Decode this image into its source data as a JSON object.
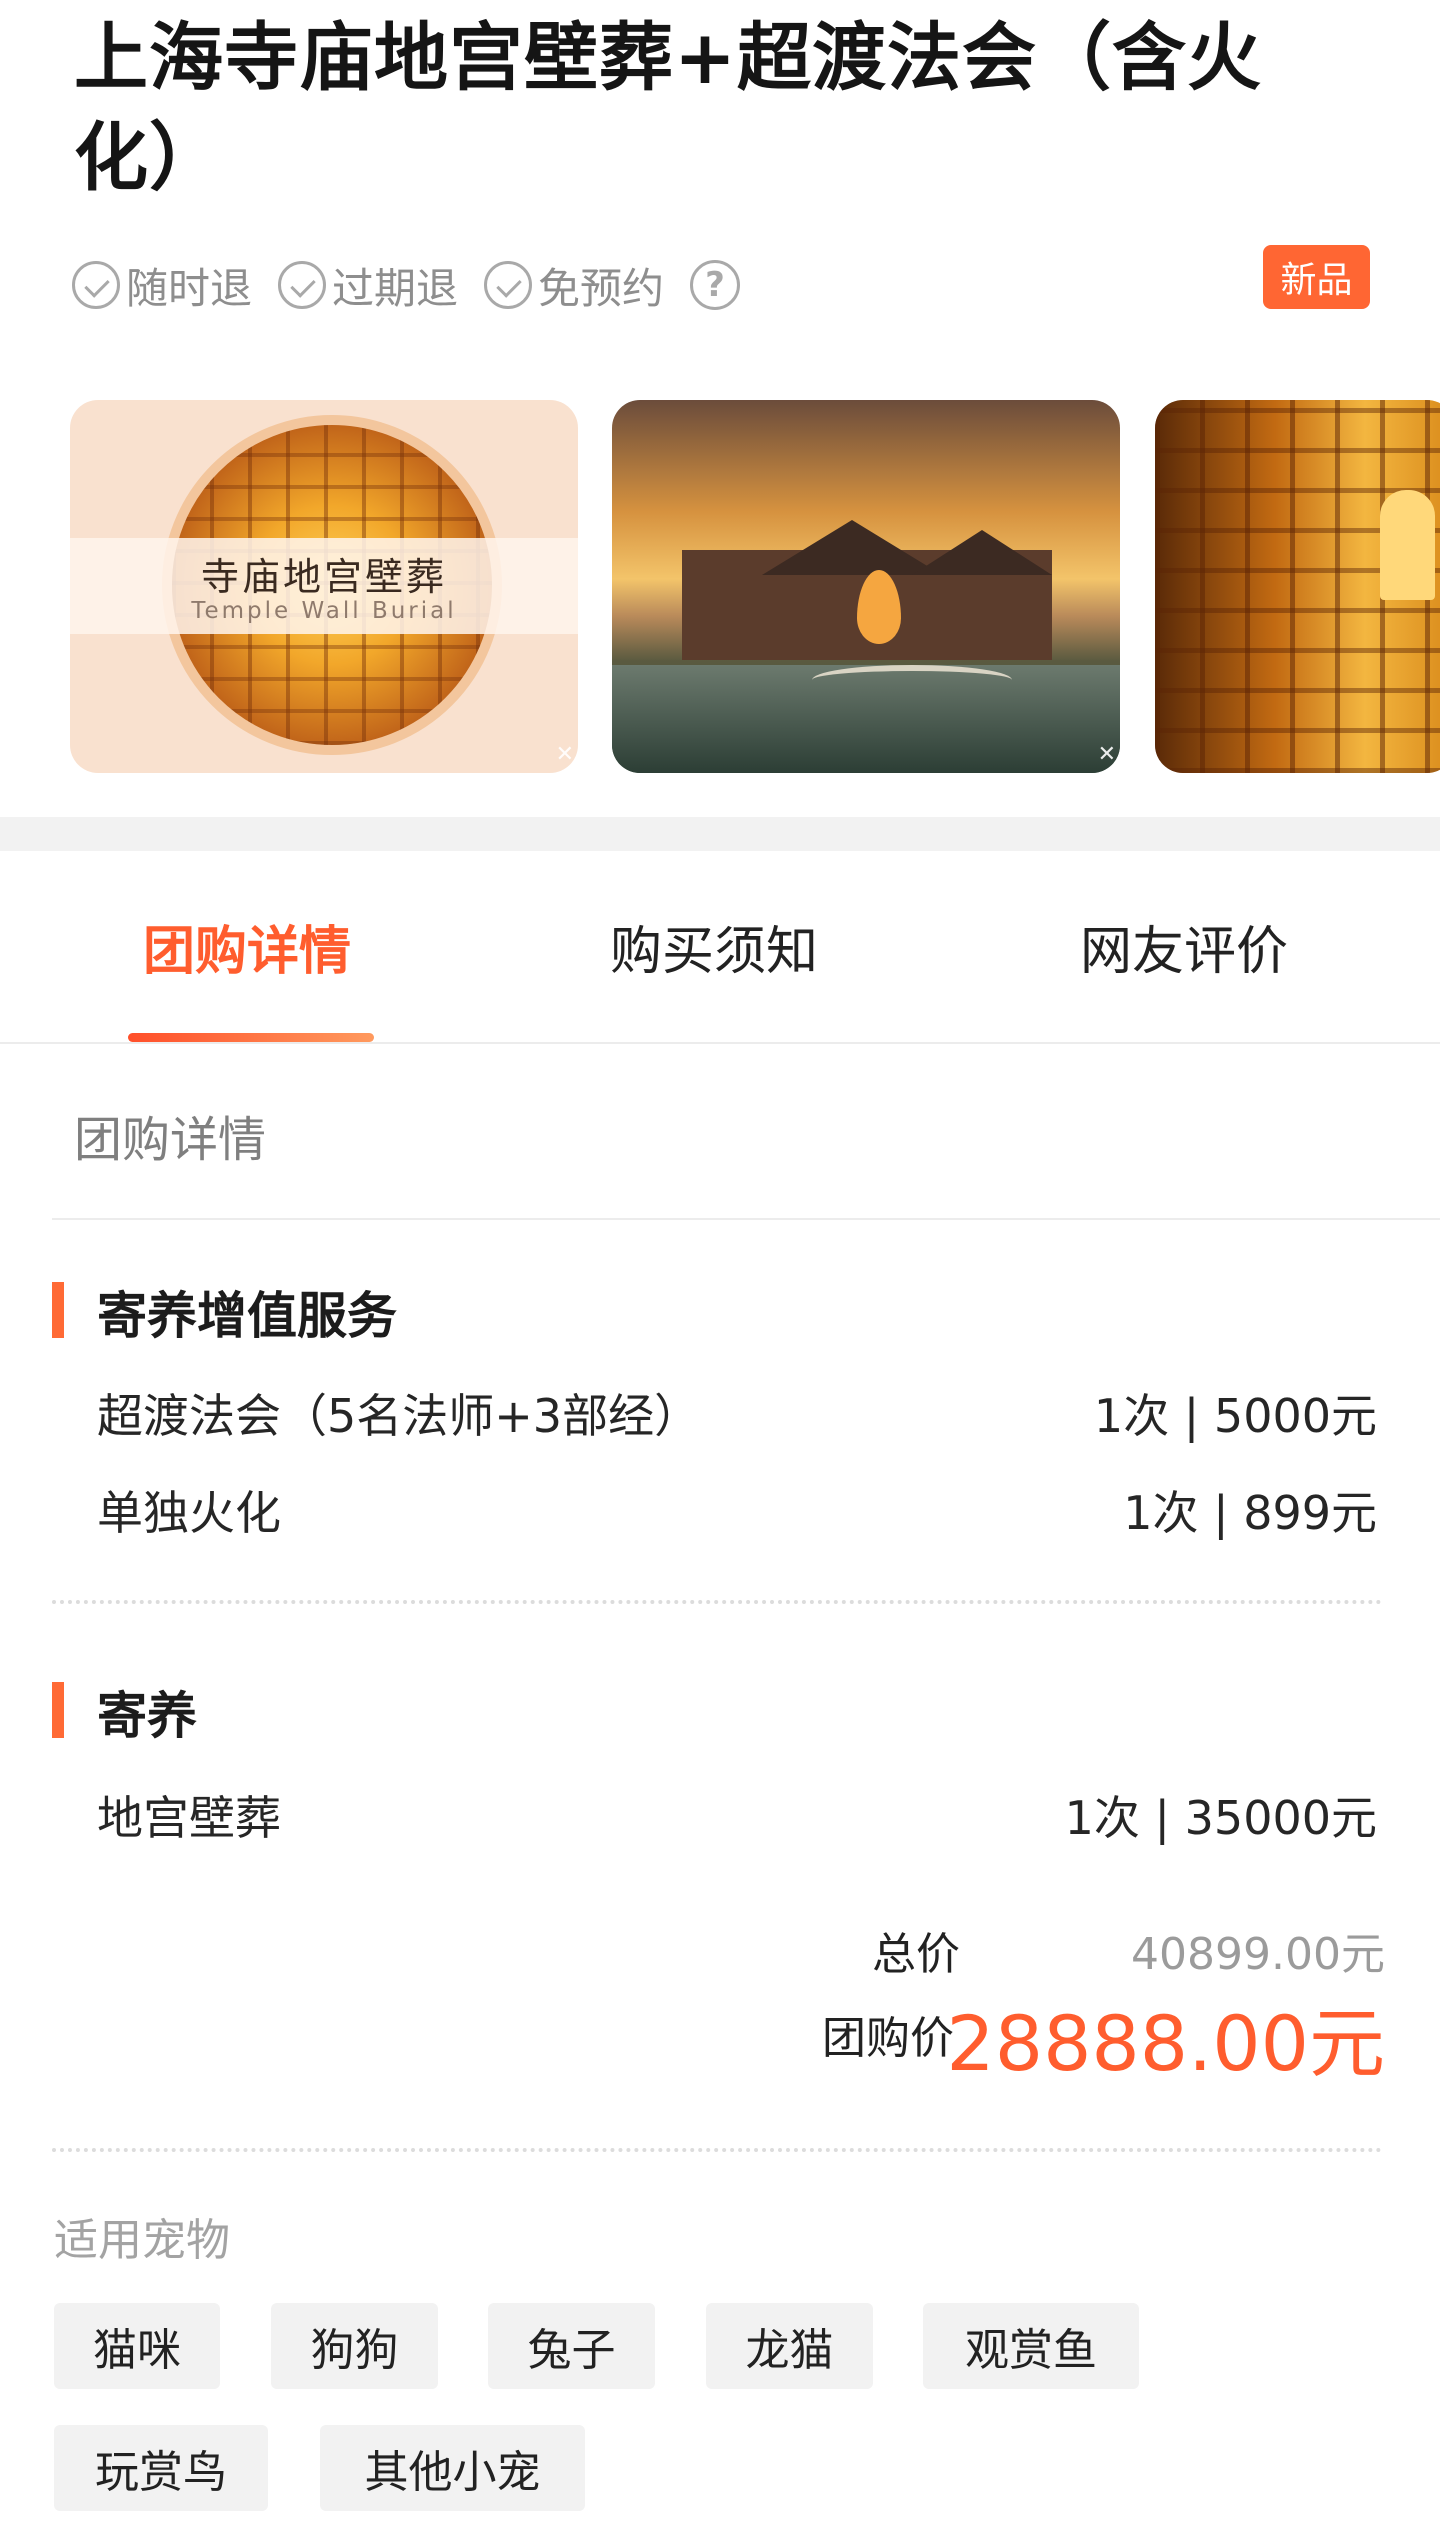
{
  "product": {
    "title": "上海寺庙地宫壁葬+超渡法会（含火化）",
    "tags": [
      "随时退",
      "过期退",
      "免预约"
    ],
    "badge": "新品"
  },
  "gallery": {
    "photo1_title_cn": "寺庙地宫壁葬",
    "photo1_title_en": "Temple Wall Burial"
  },
  "tabs": [
    "团购详情",
    "购买须知",
    "网友评价"
  ],
  "details": {
    "section_title": "团购详情",
    "groups": [
      {
        "title": "寄养增值服务",
        "items": [
          {
            "name": "超渡法会（5名法师+3部经）",
            "qty": "1次 | 5000元"
          },
          {
            "name": "单独火化",
            "qty": "1次 | 899元"
          }
        ]
      },
      {
        "title": "寄养",
        "items": [
          {
            "name": "地宫壁葬",
            "qty": "1次 | 35000元"
          }
        ]
      }
    ],
    "summary": {
      "total_label": "总价",
      "total_value": "40899.00元",
      "group_label": "团购价",
      "group_value": "28888.00元"
    }
  },
  "pets": {
    "title": "适用宠物",
    "items": [
      "猫咪",
      "狗狗",
      "兔子",
      "龙猫",
      "观赏鱼",
      "玩赏鸟",
      "其他小宠"
    ]
  },
  "colors": {
    "accent": "#ff5d2e",
    "badge": "#ff6633",
    "bar": "#ff6a35"
  }
}
